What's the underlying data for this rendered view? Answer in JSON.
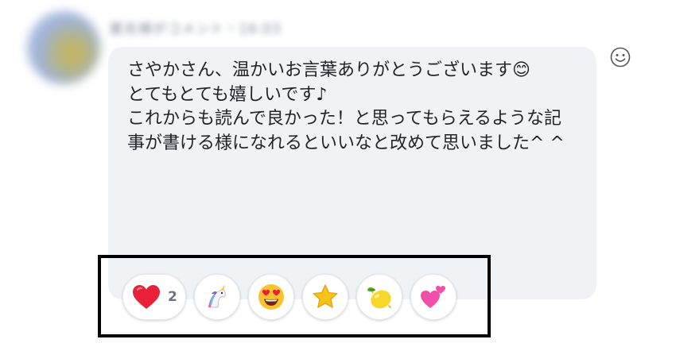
{
  "author_meta": "匿名様がコメント・16:03",
  "message": {
    "text": "さやかさん、温かいお言葉ありがとうございます😊\nとてもとても嬉しいです♪\nこれからも読んで良かった！と思ってもらえるような記事が書ける様になれるといいなと改めて思いました^ ^"
  },
  "reactions": [
    {
      "emoji": "heart",
      "count": "2"
    },
    {
      "emoji": "unicorn"
    },
    {
      "emoji": "heart-eyes"
    },
    {
      "emoji": "star"
    },
    {
      "emoji": "lemon"
    },
    {
      "emoji": "two-hearts"
    }
  ],
  "colors": {
    "bubble": "#eff3f6",
    "text": "#222428",
    "highlight_border": "#000000",
    "heart": "#e8203a",
    "count": "#6b7280"
  }
}
